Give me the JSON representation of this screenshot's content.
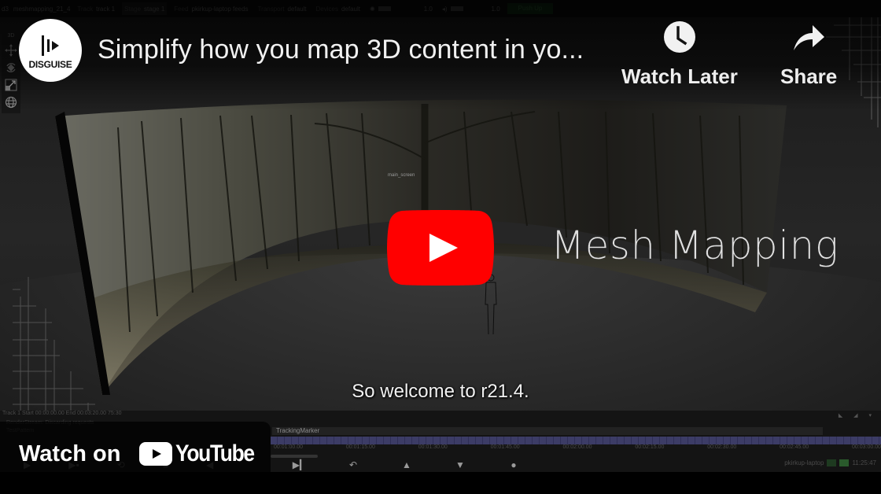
{
  "d3_app": {
    "topbar": {
      "app_id": "d3",
      "project": "meshmapping_21_4",
      "track_label": "Track",
      "track_value": "track 1",
      "stage_label": "Stage",
      "stage_value": "stage 1",
      "feed_label": "Feed",
      "feed_value": "pkirkup-laptop feeds",
      "transport_label": "Transport",
      "transport_value": "default",
      "devices_label": "Devices",
      "devices_value": "default",
      "brightness_value": "1.0",
      "volume_value": "1.0",
      "sync_button": "Push Up"
    },
    "side_toolbar": {
      "mode_label": "3D",
      "tools": [
        "move-tool",
        "rotate-tool",
        "scale-tool",
        "globe-tool"
      ]
    },
    "viewport": {
      "screen_object_label": "main_screen",
      "overlay_title": "Mesh Mapping"
    },
    "bottom": {
      "status_row": "Track 1   Start 00:00:00.00   End 00:03:20.00   75:30",
      "message_1": "RenderStream: Discarding requests",
      "message_2": "TestPattern",
      "track_layer": "TrackingMarker",
      "timecodes": [
        "00:01:00.00",
        "00:01:15.00",
        "00:01:30.00",
        "00:01:45.00",
        "00:02:00.00",
        "00:02:15.00",
        "00:02:30.00",
        "00:02:45.00",
        "00:03:00.00"
      ],
      "transport_buttons": [
        "play-to-end",
        "return",
        "previous-cue",
        "next-cue",
        "record"
      ],
      "machine_name": "pkirkup-laptop",
      "clock": "11:25:47"
    }
  },
  "subtitle": "So welcome to r21.4.",
  "youtube": {
    "channel_name": "DISGUISE",
    "video_title": "Simplify how you map 3D content in yo...",
    "watch_later_label": "Watch Later",
    "share_label": "Share",
    "watch_on_label": "Watch on",
    "youtube_wordmark": "YouTube",
    "colors": {
      "play_red": "#ff0000",
      "text_white": "#f1f1f1"
    }
  }
}
